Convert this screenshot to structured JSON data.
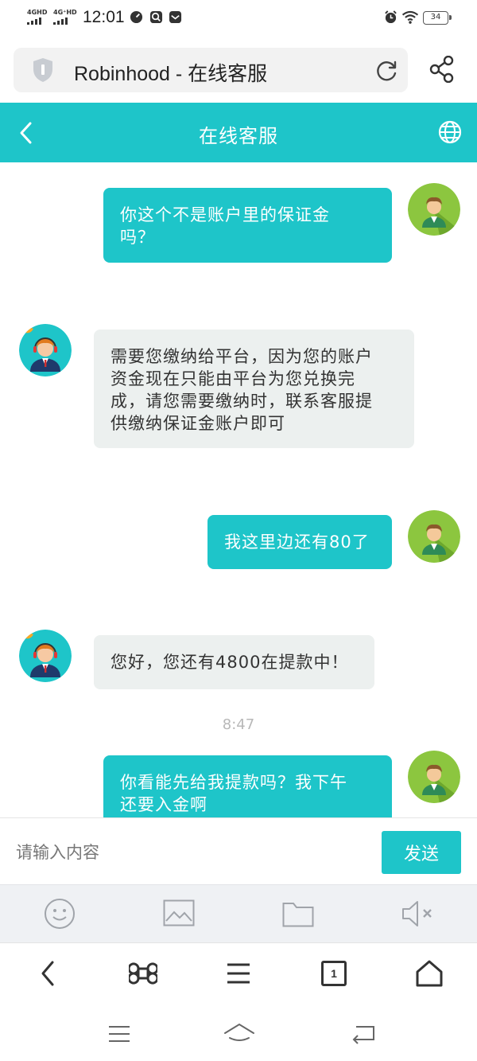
{
  "status_bar": {
    "signal_1": "4GHD",
    "signal_2": "4G⁺HD",
    "time": "12:01",
    "battery": "34"
  },
  "browser": {
    "page_title": "Robinhood - 在线客服"
  },
  "header": {
    "title": "在线客服"
  },
  "messages": [
    {
      "side": "me",
      "text_lines": [
        "你这个不是账户里的保证金",
        "吗？"
      ]
    },
    {
      "side": "agent",
      "text_lines": [
        "需要您缴纳给平台，因为您的账户",
        "资金现在只能由平台为您兑换完",
        "成，请您需要缴纳时，联系客服提",
        "供缴纳保证金账户即可"
      ]
    },
    {
      "side": "me",
      "text_lines": [
        "我这里边还有80了"
      ]
    },
    {
      "side": "agent",
      "text_lines": [
        "您好，您还有4800在提款中！"
      ]
    },
    {
      "side": "time",
      "text": "8:47"
    },
    {
      "side": "me",
      "text_lines": [
        "你看能先给我提款吗？我下午",
        "还要入金啊"
      ]
    }
  ],
  "input": {
    "placeholder": "请输入内容",
    "send_label": "发送"
  },
  "toolbar": {
    "icons": [
      "emoji-icon",
      "image-icon",
      "folder-icon",
      "mute-icon"
    ]
  },
  "browser_nav": {
    "tab_count": "1"
  },
  "colors": {
    "accent": "#1ec5c9",
    "agent_bubble": "#ecf0ef",
    "tools_bg": "#eff1f4"
  }
}
